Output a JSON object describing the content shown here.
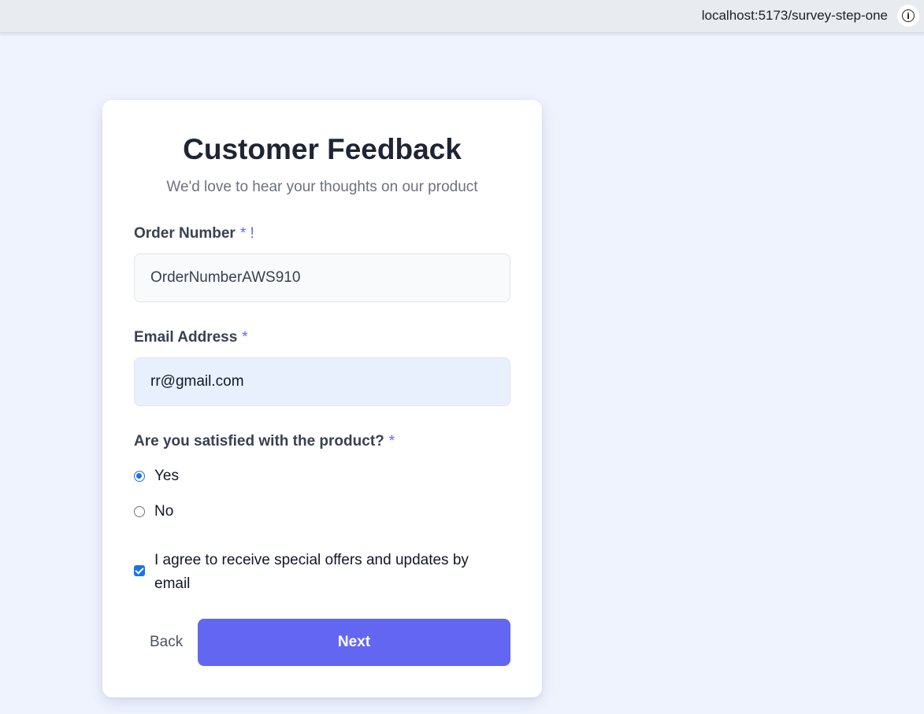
{
  "browser": {
    "url": "localhost:5173/survey-step-one",
    "info_icon": "info-icon"
  },
  "form": {
    "title": "Customer Feedback",
    "subtitle": "We'd love to hear your thoughts on our product",
    "order_number": {
      "label": "Order Number",
      "marker": "* !",
      "value": "OrderNumberAWS910"
    },
    "email": {
      "label": "Email Address",
      "marker": "*",
      "value": "rr@gmail.com"
    },
    "satisfaction": {
      "question": "Are you satisfied with the product?",
      "marker": "*",
      "options": [
        {
          "label": "Yes",
          "selected": true
        },
        {
          "label": "No",
          "selected": false
        }
      ]
    },
    "consent": {
      "label": "I agree to receive special offers and updates by email",
      "checked": true
    },
    "actions": {
      "back_label": "Back",
      "next_label": "Next"
    }
  },
  "colors": {
    "accent": "#6366f1",
    "control_blue": "#1a73e8",
    "page_background": "#eef3fe"
  }
}
